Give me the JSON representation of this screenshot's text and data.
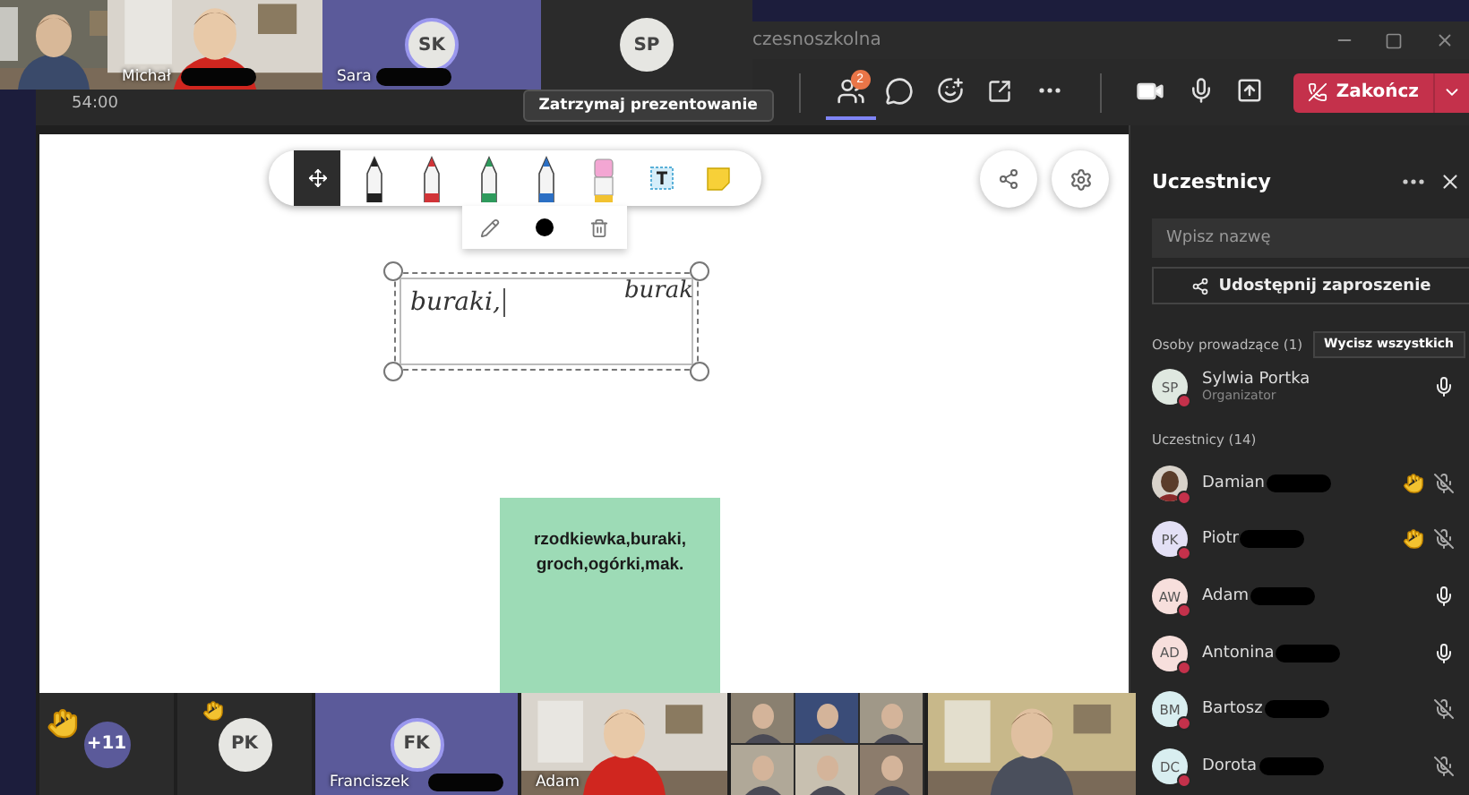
{
  "top_tiles": [
    {
      "kind": "video"
    },
    {
      "kind": "video",
      "name": "Michał",
      "redacted": true
    },
    {
      "kind": "avatar",
      "initials": "SK",
      "name": "Sara",
      "redacted": true,
      "speaking": true
    },
    {
      "kind": "avatar",
      "initials": "SP",
      "speaking": false
    }
  ],
  "window": {
    "title": "czesnoszkolna"
  },
  "meeting_bar": {
    "timer": "54:00",
    "stop_button": "Zatrzymaj prezentowanie",
    "controls": [
      {
        "kind": "people",
        "selected": true,
        "badge": "2"
      },
      {
        "kind": "chat",
        "selected": false
      },
      {
        "kind": "reactions",
        "selected": false
      },
      {
        "kind": "rooms",
        "selected": false
      },
      {
        "kind": "more",
        "selected": false
      }
    ],
    "devices": [
      {
        "kind": "camera"
      },
      {
        "kind": "mic"
      },
      {
        "kind": "share"
      }
    ],
    "end_button": "Zakończ"
  },
  "whiteboard": {
    "tools": [
      {
        "kind": "move",
        "selected": true
      },
      {
        "kind": "pen",
        "color": "#222222",
        "selected": false
      },
      {
        "kind": "pen",
        "color": "#d13438",
        "selected": false
      },
      {
        "kind": "pen",
        "color": "#2e9a5c",
        "selected": false
      },
      {
        "kind": "pen",
        "color": "#2b6fc4",
        "selected": false
      },
      {
        "kind": "eraser",
        "selected": false
      },
      {
        "kind": "text",
        "selected": false
      },
      {
        "kind": "note",
        "selected": false
      }
    ],
    "text_box": {
      "text": "buraki,",
      "overflow_text": "burak"
    },
    "sticky_note": {
      "lines": [
        "rzodkiewka,buraki,",
        "groch,ogórki,mak."
      ]
    }
  },
  "sidebar": {
    "title": "Uczestnicy",
    "search": {
      "placeholder": "Wpisz nazwę"
    },
    "invite_button": "Udostępnij zaproszenie",
    "presenters": {
      "label": "Osoby prowadzące (1)",
      "mute_all": "Wycisz wszystkich",
      "people": [
        {
          "name": "Sylwia Portka",
          "role": "Organizator",
          "initials": "SP",
          "color": "#dfe8e0",
          "hand_raised": false,
          "muted": false
        }
      ]
    },
    "attendees": {
      "label": "Uczestnicy (14)",
      "people": [
        {
          "name": "Damian",
          "hand_raised": true,
          "muted": true,
          "redacted": true
        },
        {
          "name": "Piotr",
          "kind": "initials",
          "initials": "PK",
          "color": "#e3e0f5",
          "hand_raised": true,
          "muted": true,
          "redacted": true
        },
        {
          "name": "Adam",
          "kind": "initials",
          "initials": "AW",
          "color": "#f7dfdc",
          "hand_raised": false,
          "muted": false,
          "redacted": true
        },
        {
          "name": "Antonina",
          "kind": "initials",
          "initials": "AD",
          "color": "#f7dfdc",
          "hand_raised": false,
          "muted": false,
          "redacted": true
        },
        {
          "name": "Bartosz",
          "kind": "initials",
          "initials": "BM",
          "color": "#d9eef0",
          "hand_raised": false,
          "muted": true,
          "redacted": true
        },
        {
          "name": "Dorota",
          "kind": "initials",
          "initials": "DC",
          "color": "#d9eef0",
          "hand_raised": false,
          "muted": true,
          "redacted": true
        }
      ]
    }
  },
  "bottom_tiles": [
    {
      "kind": "overflow",
      "count": "+11",
      "hand_raised": true
    },
    {
      "kind": "avatar",
      "initials": "PK",
      "hand_raised": true,
      "speaking": false
    },
    {
      "kind": "avatar",
      "initials": "FK",
      "name": "Franciszek",
      "redacted": true,
      "speaking": true
    },
    {
      "kind": "video",
      "name": "Adam"
    },
    {
      "kind": "grid"
    },
    {
      "kind": "video"
    }
  ]
}
